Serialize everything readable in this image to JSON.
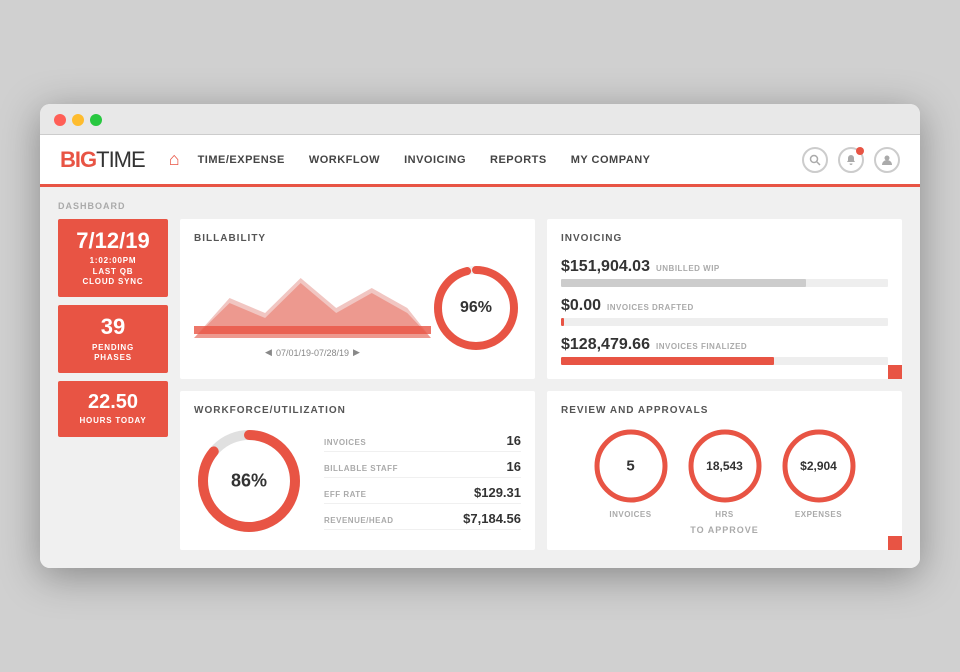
{
  "browser": {
    "dots": [
      "red",
      "yellow",
      "green"
    ]
  },
  "nav": {
    "logo_big": "BIG",
    "logo_time": "TIME",
    "links": [
      "TIME/EXPENSE",
      "WORKFLOW",
      "INVOICING",
      "REPORTS",
      "MY COMPANY"
    ],
    "home_icon": "⌂"
  },
  "dashboard": {
    "label": "DASHBOARD",
    "stats": [
      {
        "id": "date",
        "value": "7/12/19",
        "sub": "1:02:00PM\nLAST QB\nCLOUD SYNC"
      },
      {
        "id": "phases",
        "value": "39",
        "sub": "PENDING\nPHASES"
      },
      {
        "id": "hours",
        "value": "22.50",
        "sub": "HOURS TODAY"
      }
    ],
    "billability": {
      "title": "BILLABILITY",
      "percent": "96%",
      "date_range": "07/01/19-07/28/19",
      "donut_value": 96
    },
    "invoicing": {
      "title": "INVOICING",
      "rows": [
        {
          "amount": "$151,904.03",
          "label": "UNBILLED WIP",
          "fill_pct": 75,
          "color": "#ccc"
        },
        {
          "amount": "$0.00",
          "label": "INVOICES DRAFTED",
          "fill_pct": 0,
          "color": "#e85444"
        },
        {
          "amount": "$128,479.66",
          "label": "INVOICES FINALIZED",
          "fill_pct": 65,
          "color": "#e85444"
        }
      ]
    },
    "workforce": {
      "title": "WORKFORCE/UTILIZATION",
      "percent": "86%",
      "donut_value": 86,
      "rows": [
        {
          "label": "INVOICES",
          "value": "16"
        },
        {
          "label": "BILLABLE STAFF",
          "value": "16"
        },
        {
          "label": "EFF RATE",
          "value": "$129.31"
        },
        {
          "label": "REVENUE/HEAD",
          "value": "$7,184.56"
        }
      ]
    },
    "review": {
      "title": "REVIEW AND APPROVALS",
      "items": [
        {
          "value": "5",
          "label": "INVOICES"
        },
        {
          "value": "18,543",
          "label": "HRS"
        },
        {
          "value": "$2,904",
          "label": "EXPENSES"
        }
      ],
      "sub_label": "TO APPROVE"
    }
  }
}
